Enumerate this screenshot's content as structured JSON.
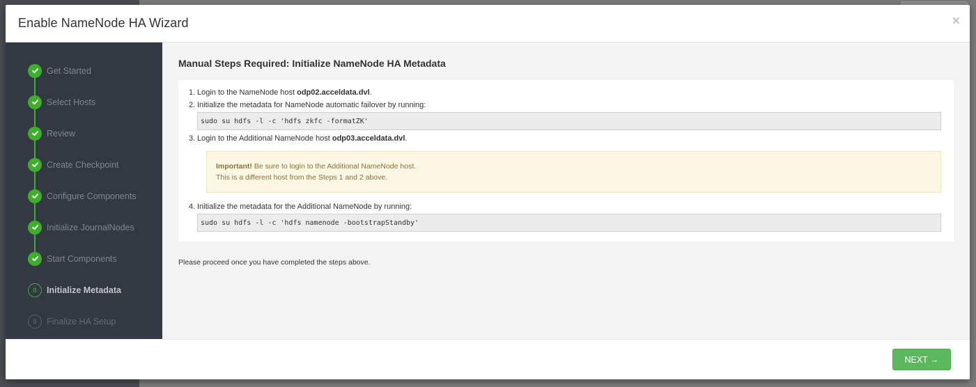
{
  "modal": {
    "title": "Enable NameNode HA Wizard",
    "close_glyph": "×"
  },
  "sidebar": {
    "steps": [
      {
        "num": "1",
        "label": "Get Started",
        "state": "done"
      },
      {
        "num": "2",
        "label": "Select Hosts",
        "state": "done"
      },
      {
        "num": "3",
        "label": "Review",
        "state": "done"
      },
      {
        "num": "4",
        "label": "Create Checkpoint",
        "state": "done"
      },
      {
        "num": "5",
        "label": "Configure Components",
        "state": "done"
      },
      {
        "num": "6",
        "label": "Initialize JournalNodes",
        "state": "done"
      },
      {
        "num": "7",
        "label": "Start Components",
        "state": "done"
      },
      {
        "num": "8",
        "label": "Initialize Metadata",
        "state": "current"
      },
      {
        "num": "9",
        "label": "Finalize HA Setup",
        "state": "todo"
      }
    ]
  },
  "content": {
    "title": "Manual Steps Required: Initialize NameNode HA Metadata",
    "step1": {
      "num": "1.",
      "text": "Login to the NameNode host ",
      "host": "odp02.acceldata.dvl",
      "suffix": "."
    },
    "step2": {
      "num": "2.",
      "text": "Initialize the metadata for NameNode automatic failover by running:",
      "code": "sudo su hdfs -l -c 'hdfs zkfc -formatZK'"
    },
    "step3": {
      "num": "3.",
      "text": "Login to the Additional NameNode host ",
      "host": "odp03.acceldata.dvl",
      "suffix": "."
    },
    "alert": {
      "strong": "Important!",
      "line1": " Be sure to login to the Additional NameNode host.",
      "line2": "This is a different host from the Steps 1 and 2 above."
    },
    "step4": {
      "num": "4.",
      "text": "Initialize the metadata for the Additional NameNode by running:",
      "code": "sudo su hdfs -l -c 'hdfs namenode -bootstrapStandby'"
    },
    "footnote": "Please proceed once you have completed the steps above."
  },
  "footer": {
    "next_label": "NEXT →"
  },
  "colors": {
    "success": "#3fae2a",
    "sidebar_bg": "#323943",
    "button": "#5cb85c"
  }
}
